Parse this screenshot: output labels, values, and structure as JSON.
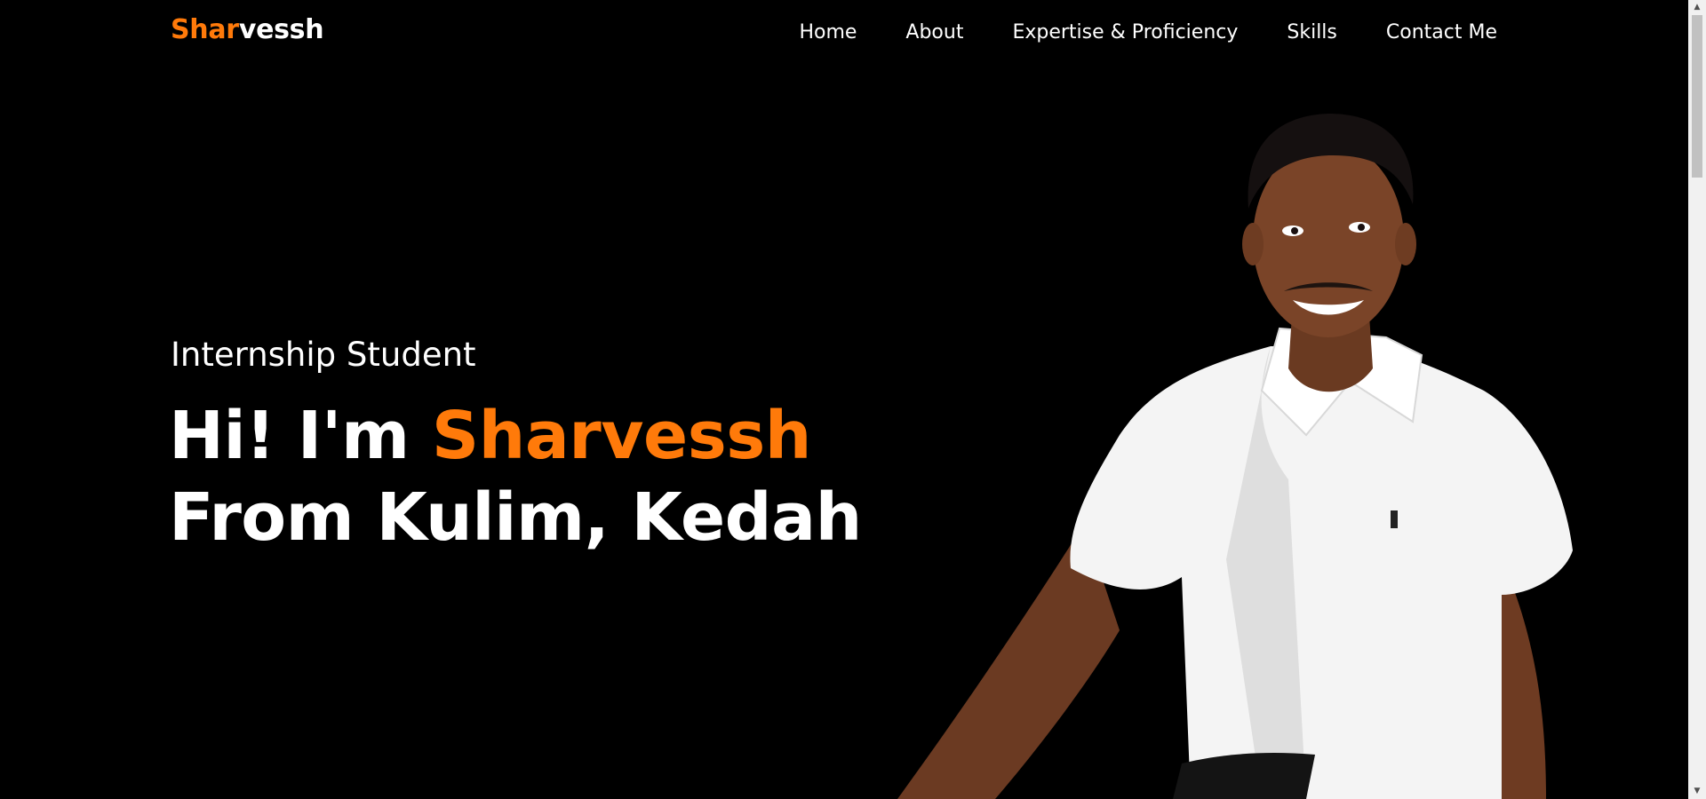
{
  "header": {
    "logo_part1": "Shar",
    "logo_part2": "vessh",
    "nav": [
      {
        "label": "Home"
      },
      {
        "label": "About"
      },
      {
        "label": "Expertise & Proficiency"
      },
      {
        "label": "Skills"
      },
      {
        "label": "Contact Me"
      }
    ]
  },
  "hero": {
    "subtitle": "Internship Student",
    "line1_prefix": "Hi! I'm ",
    "line1_name": "Sharvessh",
    "line2": "From Kulim, Kedah"
  },
  "colors": {
    "background": "#000000",
    "accent": "#ff7a0a",
    "text": "#ffffff"
  },
  "icons": {
    "scroll_up": "triangle-up-icon",
    "scroll_down": "triangle-down-icon"
  }
}
